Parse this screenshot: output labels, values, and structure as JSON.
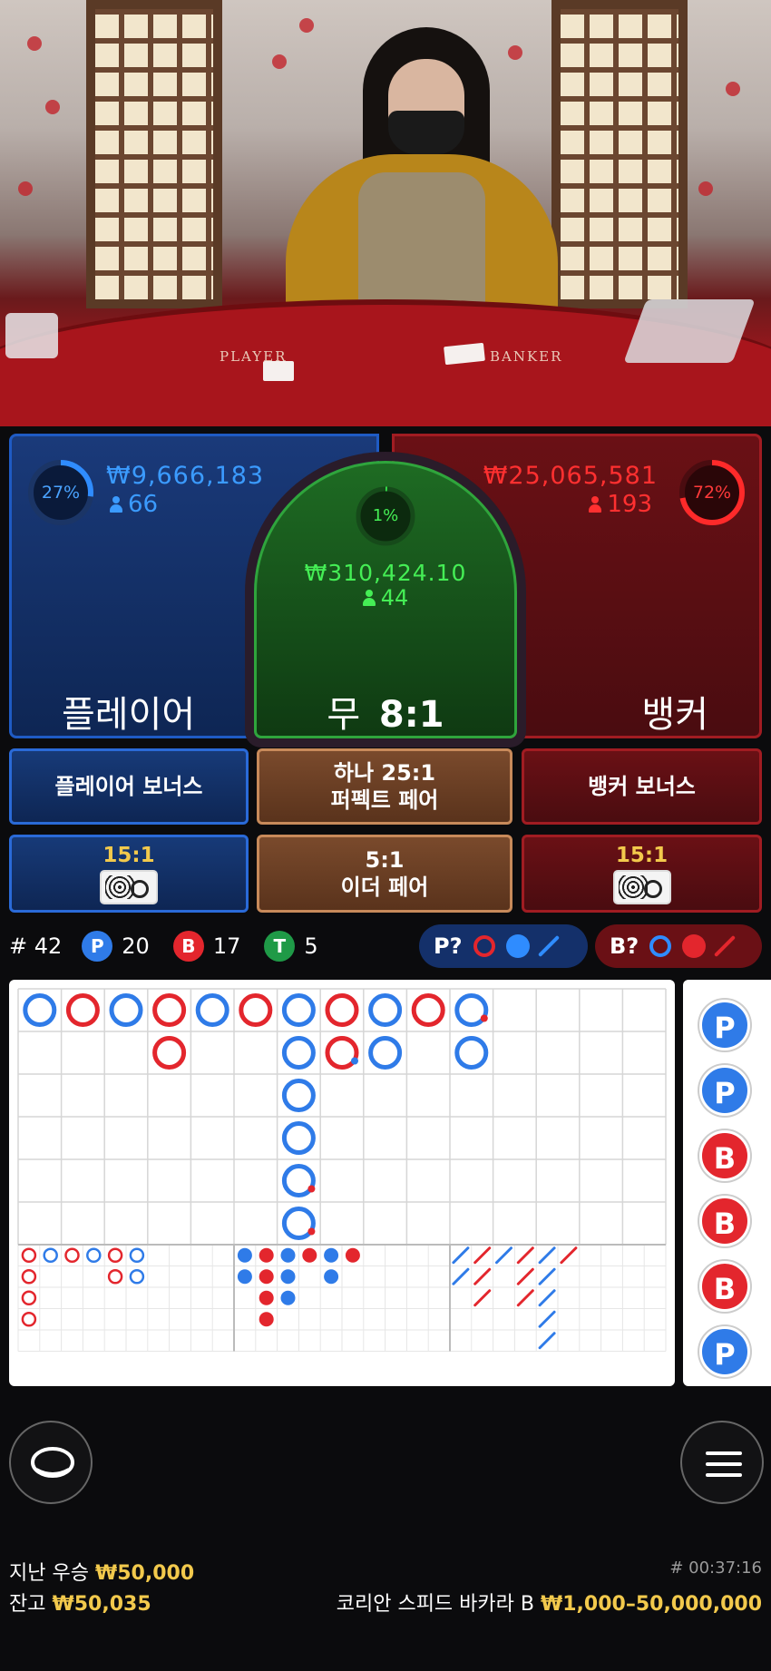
{
  "video": {
    "felt_player": "PLAYER",
    "felt_banker": "BANKER"
  },
  "player": {
    "percent": "27%",
    "percent_value": 27,
    "amount": "₩9,666,183",
    "count": "66",
    "title": "플레이어",
    "color": "#2f8cff"
  },
  "tie": {
    "percent": "1%",
    "percent_value": 1,
    "amount": "₩310,424.10",
    "count": "44",
    "title_a": "무",
    "title_b": "8:1",
    "color": "#35e04a"
  },
  "banker": {
    "percent": "72%",
    "percent_value": 72,
    "amount": "₩25,065,581",
    "count": "193",
    "title": "뱅커",
    "color": "#ff2a2a"
  },
  "side_bets": {
    "player_bonus": "플레이어 보너스",
    "either_pair_line1": "하나 25:1",
    "either_pair_line2": "퍼펙트 페어",
    "banker_bonus": "뱅커 보너스",
    "player_pair_odds": "15:1",
    "either_pair_odds": "5:1",
    "either_pair_label": "이더 페어",
    "banker_pair_odds": "15:1",
    "pair_icon": "card-pair-icon"
  },
  "stats": {
    "round": "# 42",
    "p_letter": "P",
    "p_count": "20",
    "b_letter": "B",
    "b_count": "17",
    "t_letter": "T",
    "t_count": "5",
    "p_predict": "P?",
    "b_predict": "B?"
  },
  "bead_road": {
    "letters": [
      "P",
      "P",
      "B",
      "B",
      "B",
      "P"
    ]
  },
  "footer": {
    "last_win_label": "지난 우승",
    "last_win_value": "₩50,000",
    "balance_label": "잔고",
    "balance_value": "₩50,035",
    "game_id": "# 00:37:16",
    "table_name": "코리안 스피드 바카라 B",
    "limits": "₩1,000–50,000,000"
  },
  "colors": {
    "player_blue": "#2f8cff",
    "banker_red": "#e3262d",
    "tie_green": "#35e04a",
    "gold": "#f2c94c"
  }
}
